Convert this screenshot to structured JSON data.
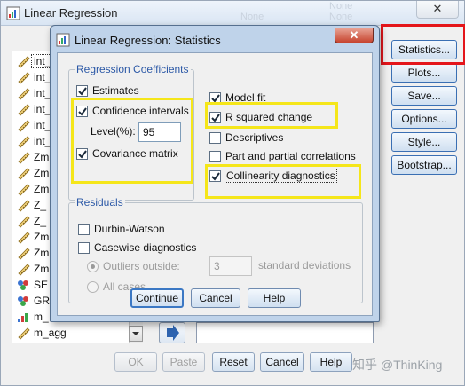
{
  "parent": {
    "title": "Linear Regression",
    "close_glyph": "✕",
    "ghost_texts": [
      "None",
      "None",
      "None"
    ],
    "variables": [
      {
        "label": "int_",
        "icon": "ruler-icon",
        "selected": true
      },
      {
        "label": "int_",
        "icon": "ruler-icon"
      },
      {
        "label": "int_",
        "icon": "ruler-icon"
      },
      {
        "label": "int_",
        "icon": "ruler-icon"
      },
      {
        "label": "int_",
        "icon": "ruler-icon"
      },
      {
        "label": "int_",
        "icon": "ruler-icon"
      },
      {
        "label": "Zm",
        "icon": "ruler-icon"
      },
      {
        "label": "Zm",
        "icon": "ruler-icon"
      },
      {
        "label": "Zm",
        "icon": "ruler-icon"
      },
      {
        "label": "Z_",
        "icon": "ruler-icon"
      },
      {
        "label": "Z_",
        "icon": "ruler-icon"
      },
      {
        "label": "Zm",
        "icon": "ruler-icon"
      },
      {
        "label": "Zm",
        "icon": "ruler-icon"
      },
      {
        "label": "Zm",
        "icon": "ruler-icon"
      },
      {
        "label": "SE",
        "icon": "nominal-icon"
      },
      {
        "label": "GR",
        "icon": "nominal-icon"
      },
      {
        "label": "m_",
        "icon": "ordinal-icon"
      },
      {
        "label": "m_agg",
        "icon": "ruler-icon"
      }
    ],
    "side_buttons": [
      "Statistics...",
      "Plots...",
      "Save...",
      "Options...",
      "Style...",
      "Bootstrap..."
    ],
    "bottom_buttons": {
      "ok": "OK",
      "paste": "Paste",
      "reset": "Reset",
      "cancel": "Cancel",
      "help": "Help"
    },
    "watermark": "知乎 @ThinKing"
  },
  "dialog": {
    "title": "Linear Regression: Statistics",
    "close_glyph": "✕",
    "regression_coefficients": {
      "legend": "Regression Coefficients",
      "estimates": {
        "label": "Estimates",
        "checked": true
      },
      "confidence_intervals": {
        "label": "Confidence intervals",
        "checked": true
      },
      "level_label": "Level(%):",
      "level_value": "95",
      "covariance_matrix": {
        "label": "Covariance matrix",
        "checked": true
      }
    },
    "right_options": {
      "model_fit": {
        "label": "Model fit",
        "checked": true
      },
      "r_squared_change": {
        "label": "R squared change",
        "checked": true
      },
      "descriptives": {
        "label": "Descriptives",
        "checked": false
      },
      "part_partial": {
        "label": "Part and partial correlations",
        "checked": false
      },
      "collinearity": {
        "label": "Collinearity diagnostics",
        "checked": true
      }
    },
    "residuals": {
      "legend": "Residuals",
      "durbin_watson": {
        "label": "Durbin-Watson",
        "checked": false
      },
      "casewise": {
        "label": "Casewise diagnostics",
        "checked": false
      },
      "outliers_outside": {
        "label": "Outliers outside:",
        "selected": true,
        "enabled": false
      },
      "outliers_value": "3",
      "std_dev_label": "standard deviations",
      "all_cases": {
        "label": "All cases",
        "selected": false,
        "enabled": false
      }
    },
    "buttons": {
      "continue": "Continue",
      "cancel": "Cancel",
      "help": "Help"
    }
  },
  "colors": {
    "highlight_yellow": "#f5e61a",
    "highlight_red": "#e4161b",
    "dialog_frame": "#bfd3ea",
    "group_label": "#2b58a6"
  }
}
